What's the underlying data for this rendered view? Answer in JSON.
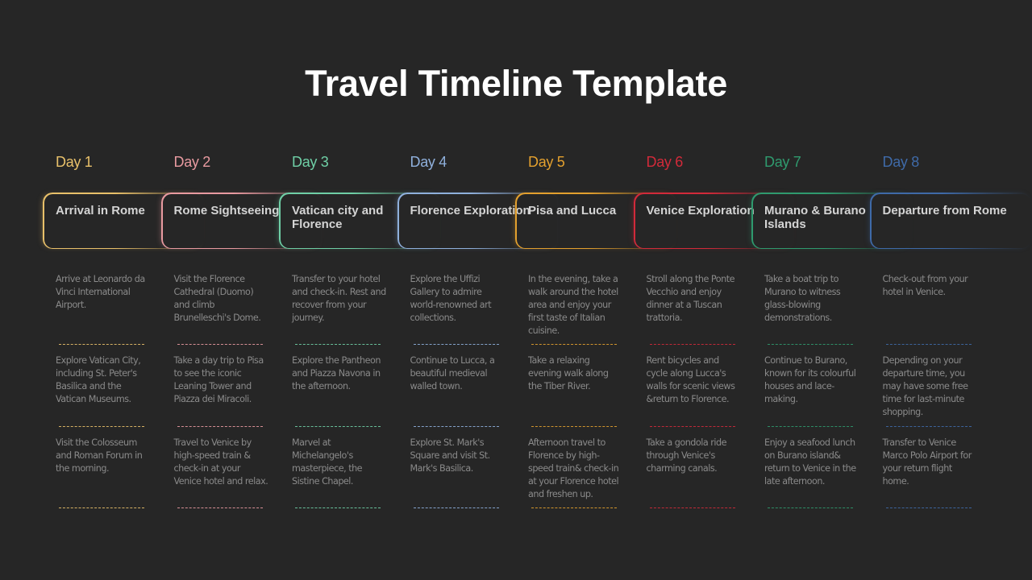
{
  "title": "Travel Timeline Template",
  "days": [
    {
      "label": "Day 1",
      "color": "#e8c06a",
      "title": "Arrival in Rome",
      "activities": [
        "Arrive at Leonardo da Vinci International Airport.",
        "Explore Vatican City, including St. Peter's Basilica and the Vatican Museums.",
        "Visit the Colosseum and Roman Forum in the morning."
      ]
    },
    {
      "label": "Day 2",
      "color": "#e89aa0",
      "title": "Rome Sightseeing",
      "activities": [
        "Visit the Florence Cathedral (Duomo) and climb Brunelleschi's Dome.",
        "Take a day trip to Pisa to see the iconic Leaning Tower and Piazza dei Miracoli.",
        "Travel to Venice by high-speed train & check-in at your Venice hotel and relax."
      ]
    },
    {
      "label": "Day 3",
      "color": "#6fcfa6",
      "title": "Vatican city and Florence",
      "activities": [
        "Transfer to your hotel and check-in. Rest and recover from your journey.",
        "Explore the Pantheon and Piazza Navona in the afternoon.",
        "Marvel at Michelangelo's masterpiece, the Sistine Chapel."
      ]
    },
    {
      "label": "Day 4",
      "color": "#8fb0dc",
      "title": "Florence Exploration",
      "activities": [
        "Explore the Uffizi Gallery to admire world-renowned art collections.",
        "Continue to Lucca, a beautiful medieval walled town.",
        "Explore St. Mark's Square and visit St. Mark's Basilica."
      ]
    },
    {
      "label": "Day 5",
      "color": "#e3a02e",
      "title": "Pisa and Lucca",
      "activities": [
        "In the evening, take a walk around the hotel area and enjoy your first taste of Italian cuisine.",
        "Take a relaxing evening walk along the Tiber River.",
        "Afternoon travel to Florence by high-speed train& check-in at your Florence hotel and freshen up."
      ]
    },
    {
      "label": "Day 6",
      "color": "#d22a3a",
      "title": "Venice Exploration",
      "activities": [
        "Stroll along the Ponte Vecchio and enjoy dinner at a Tuscan trattoria.",
        "Rent bicycles and cycle along Lucca's walls for scenic views &return to Florence.",
        "Take a gondola ride through Venice's charming canals."
      ]
    },
    {
      "label": "Day 7",
      "color": "#2f9a6e",
      "title": "Murano & Burano Islands",
      "activities": [
        "Take a boat trip to Murano to witness glass-blowing demonstrations.",
        "Continue to Burano, known for its colourful houses and lace-making.",
        "Enjoy a seafood lunch on Burano island& return to Venice in the late afternoon."
      ]
    },
    {
      "label": "Day 8",
      "color": "#3f6aa8",
      "title": "Departure from Rome",
      "activities": [
        "Check-out from your hotel in Venice.",
        "Depending on your departure time, you may have some free time for last-minute shopping.",
        "Transfer to Venice Marco Polo Airport for your return flight home."
      ]
    }
  ]
}
